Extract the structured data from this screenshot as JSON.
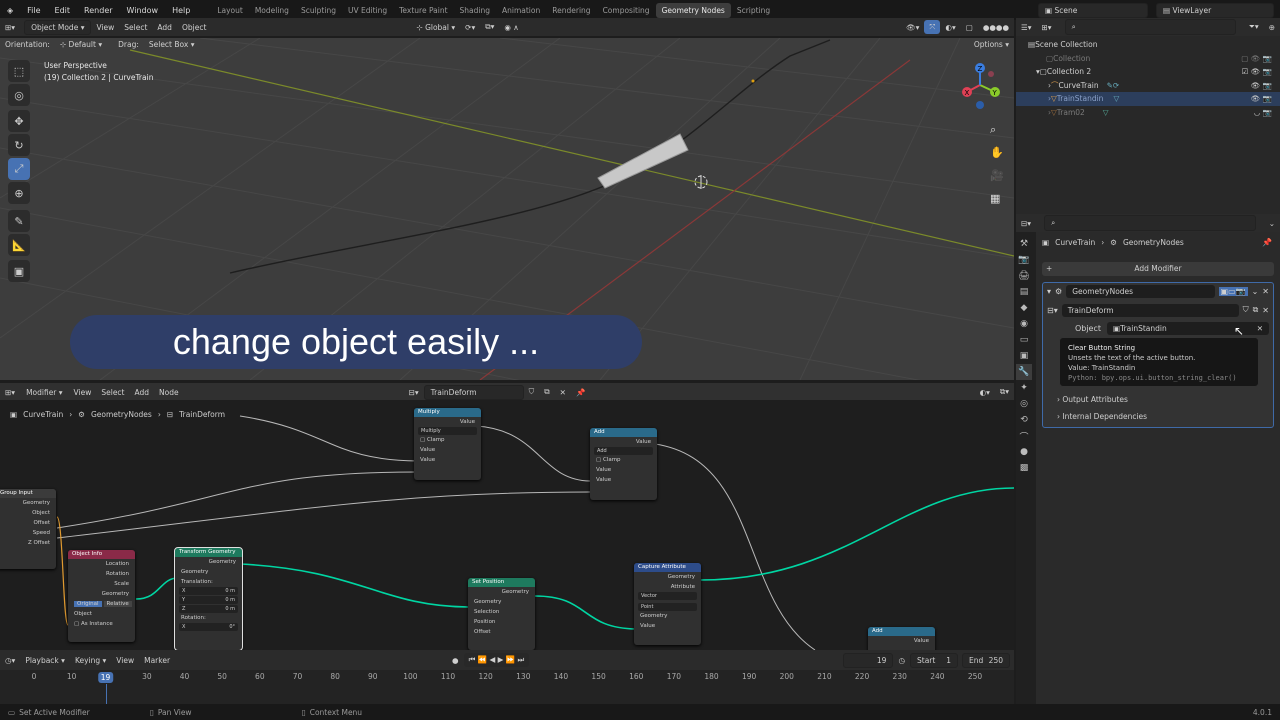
{
  "menu": [
    "File",
    "Edit",
    "Render",
    "Window",
    "Help"
  ],
  "workspaces": [
    "Layout",
    "Modeling",
    "Sculpting",
    "UV Editing",
    "Texture Paint",
    "Shading",
    "Animation",
    "Rendering",
    "Compositing",
    "Geometry Nodes",
    "Scripting"
  ],
  "active_workspace": "Geometry Nodes",
  "scene": "Scene",
  "view_layer": "ViewLayer",
  "viewport": {
    "mode": "Object Mode",
    "menus": [
      "View",
      "Select",
      "Add",
      "Object"
    ],
    "transform": "Global",
    "orientation_label": "Orientation:",
    "orientation": "Default",
    "drag_label": "Drag:",
    "drag": "Select Box",
    "options": "Options",
    "info1": "User Perspective",
    "info2": "(19) Collection 2 | CurveTrain",
    "gizmo": {
      "x": "X",
      "y": "Y",
      "z": "Z"
    }
  },
  "caption": "change object easily ...",
  "node_editor": {
    "type": "Modifier",
    "menus": [
      "View",
      "Select",
      "Add",
      "Node"
    ],
    "tree": "TrainDeform",
    "breadcrumb": [
      "CurveTrain",
      "GeometryNodes",
      "TrainDeform"
    ]
  },
  "nodes": {
    "group_input": {
      "title": "Group Input",
      "outputs": [
        "Geometry",
        "Object",
        "Offset",
        "Speed",
        "Z Offset"
      ]
    },
    "math1": {
      "title": "Multiply",
      "value": "Value",
      "op": "Multiply",
      "clamp": "Clamp",
      "in1": "Value",
      "in2": "Value"
    },
    "math2": {
      "title": "Add",
      "value": "Value",
      "op": "Add",
      "clamp": "Clamp",
      "in1": "Value",
      "in2": "Value"
    },
    "object_info": {
      "title": "Object Info",
      "outs": [
        "Location",
        "Rotation",
        "Scale",
        "Geometry"
      ],
      "original": "Original",
      "relative": "Relative",
      "object": "Object",
      "as_instance": "As Instance"
    },
    "transform": {
      "title": "Transform Geometry",
      "out": "Geometry",
      "in": "Geometry",
      "translation": "Translation:",
      "rotation": "Rotation:",
      "x": "X",
      "y": "Y",
      "z": "Z",
      "v": "0 m",
      "deg": "0°"
    },
    "set_position": {
      "title": "Set Position",
      "out": "Geometry",
      "ins": [
        "Geometry",
        "Selection",
        "Position",
        "Offset"
      ]
    },
    "capture": {
      "title": "Capture Attribute",
      "outs": [
        "Geometry",
        "Attribute"
      ],
      "d1": "Vector",
      "d2": "Point",
      "ins": [
        "Geometry",
        "Value"
      ]
    },
    "math3": {
      "title": "Add",
      "value": "Value"
    }
  },
  "timeline": {
    "menus": [
      "Playback",
      "Keying",
      "View",
      "Marker"
    ],
    "frame": "19",
    "start_label": "Start",
    "start": "1",
    "end_label": "End",
    "end": "250",
    "ticks": [
      "0",
      "10",
      "19",
      "30",
      "40",
      "50",
      "60",
      "70",
      "80",
      "90",
      "100",
      "110",
      "120",
      "130",
      "140",
      "150",
      "160",
      "170",
      "180",
      "190",
      "200",
      "210",
      "220",
      "230",
      "240",
      "250"
    ],
    "current": 19
  },
  "status": {
    "left": "Set Active Modifier",
    "mid": "Pan View",
    "right": "Context Menu",
    "version": "4.0.1"
  },
  "outliner": {
    "root": "Scene Collection",
    "items": [
      {
        "name": "Collection",
        "dim": true
      },
      {
        "name": "Collection 2"
      },
      {
        "name": "CurveTrain"
      },
      {
        "name": "TrainStandin",
        "selected": true
      },
      {
        "name": "Tram02",
        "dim": true
      }
    ]
  },
  "properties": {
    "crumb_obj": "CurveTrain",
    "crumb_mod": "GeometryNodes",
    "add_modifier": "Add Modifier",
    "modifier_name": "GeometryNodes",
    "group": "TrainDeform",
    "object_label": "Object",
    "object_value": "TrainStandin",
    "tooltip": {
      "title": "Clear Button String",
      "desc": "Unsets the text of the active button.",
      "value": "Value: TrainStandin",
      "python": "Python: bpy.ops.ui.button_string_clear()"
    },
    "panels": [
      "Output Attributes",
      "Internal Dependencies"
    ]
  },
  "colors": {
    "accent": "#4772b3",
    "geo_socket": "#00d6a3",
    "link": "#b8b8b8",
    "caption_bg": "#2f3e68"
  }
}
